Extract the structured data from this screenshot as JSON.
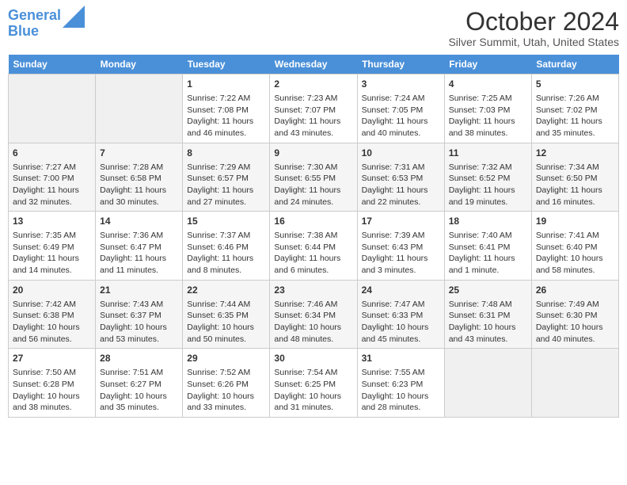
{
  "header": {
    "logo_line1": "General",
    "logo_line2": "Blue",
    "month": "October 2024",
    "location": "Silver Summit, Utah, United States"
  },
  "days_of_week": [
    "Sunday",
    "Monday",
    "Tuesday",
    "Wednesday",
    "Thursday",
    "Friday",
    "Saturday"
  ],
  "weeks": [
    [
      {
        "day": "",
        "info": ""
      },
      {
        "day": "",
        "info": ""
      },
      {
        "day": "1",
        "info": "Sunrise: 7:22 AM\nSunset: 7:08 PM\nDaylight: 11 hours and 46 minutes."
      },
      {
        "day": "2",
        "info": "Sunrise: 7:23 AM\nSunset: 7:07 PM\nDaylight: 11 hours and 43 minutes."
      },
      {
        "day": "3",
        "info": "Sunrise: 7:24 AM\nSunset: 7:05 PM\nDaylight: 11 hours and 40 minutes."
      },
      {
        "day": "4",
        "info": "Sunrise: 7:25 AM\nSunset: 7:03 PM\nDaylight: 11 hours and 38 minutes."
      },
      {
        "day": "5",
        "info": "Sunrise: 7:26 AM\nSunset: 7:02 PM\nDaylight: 11 hours and 35 minutes."
      }
    ],
    [
      {
        "day": "6",
        "info": "Sunrise: 7:27 AM\nSunset: 7:00 PM\nDaylight: 11 hours and 32 minutes."
      },
      {
        "day": "7",
        "info": "Sunrise: 7:28 AM\nSunset: 6:58 PM\nDaylight: 11 hours and 30 minutes."
      },
      {
        "day": "8",
        "info": "Sunrise: 7:29 AM\nSunset: 6:57 PM\nDaylight: 11 hours and 27 minutes."
      },
      {
        "day": "9",
        "info": "Sunrise: 7:30 AM\nSunset: 6:55 PM\nDaylight: 11 hours and 24 minutes."
      },
      {
        "day": "10",
        "info": "Sunrise: 7:31 AM\nSunset: 6:53 PM\nDaylight: 11 hours and 22 minutes."
      },
      {
        "day": "11",
        "info": "Sunrise: 7:32 AM\nSunset: 6:52 PM\nDaylight: 11 hours and 19 minutes."
      },
      {
        "day": "12",
        "info": "Sunrise: 7:34 AM\nSunset: 6:50 PM\nDaylight: 11 hours and 16 minutes."
      }
    ],
    [
      {
        "day": "13",
        "info": "Sunrise: 7:35 AM\nSunset: 6:49 PM\nDaylight: 11 hours and 14 minutes."
      },
      {
        "day": "14",
        "info": "Sunrise: 7:36 AM\nSunset: 6:47 PM\nDaylight: 11 hours and 11 minutes."
      },
      {
        "day": "15",
        "info": "Sunrise: 7:37 AM\nSunset: 6:46 PM\nDaylight: 11 hours and 8 minutes."
      },
      {
        "day": "16",
        "info": "Sunrise: 7:38 AM\nSunset: 6:44 PM\nDaylight: 11 hours and 6 minutes."
      },
      {
        "day": "17",
        "info": "Sunrise: 7:39 AM\nSunset: 6:43 PM\nDaylight: 11 hours and 3 minutes."
      },
      {
        "day": "18",
        "info": "Sunrise: 7:40 AM\nSunset: 6:41 PM\nDaylight: 11 hours and 1 minute."
      },
      {
        "day": "19",
        "info": "Sunrise: 7:41 AM\nSunset: 6:40 PM\nDaylight: 10 hours and 58 minutes."
      }
    ],
    [
      {
        "day": "20",
        "info": "Sunrise: 7:42 AM\nSunset: 6:38 PM\nDaylight: 10 hours and 56 minutes."
      },
      {
        "day": "21",
        "info": "Sunrise: 7:43 AM\nSunset: 6:37 PM\nDaylight: 10 hours and 53 minutes."
      },
      {
        "day": "22",
        "info": "Sunrise: 7:44 AM\nSunset: 6:35 PM\nDaylight: 10 hours and 50 minutes."
      },
      {
        "day": "23",
        "info": "Sunrise: 7:46 AM\nSunset: 6:34 PM\nDaylight: 10 hours and 48 minutes."
      },
      {
        "day": "24",
        "info": "Sunrise: 7:47 AM\nSunset: 6:33 PM\nDaylight: 10 hours and 45 minutes."
      },
      {
        "day": "25",
        "info": "Sunrise: 7:48 AM\nSunset: 6:31 PM\nDaylight: 10 hours and 43 minutes."
      },
      {
        "day": "26",
        "info": "Sunrise: 7:49 AM\nSunset: 6:30 PM\nDaylight: 10 hours and 40 minutes."
      }
    ],
    [
      {
        "day": "27",
        "info": "Sunrise: 7:50 AM\nSunset: 6:28 PM\nDaylight: 10 hours and 38 minutes."
      },
      {
        "day": "28",
        "info": "Sunrise: 7:51 AM\nSunset: 6:27 PM\nDaylight: 10 hours and 35 minutes."
      },
      {
        "day": "29",
        "info": "Sunrise: 7:52 AM\nSunset: 6:26 PM\nDaylight: 10 hours and 33 minutes."
      },
      {
        "day": "30",
        "info": "Sunrise: 7:54 AM\nSunset: 6:25 PM\nDaylight: 10 hours and 31 minutes."
      },
      {
        "day": "31",
        "info": "Sunrise: 7:55 AM\nSunset: 6:23 PM\nDaylight: 10 hours and 28 minutes."
      },
      {
        "day": "",
        "info": ""
      },
      {
        "day": "",
        "info": ""
      }
    ]
  ]
}
